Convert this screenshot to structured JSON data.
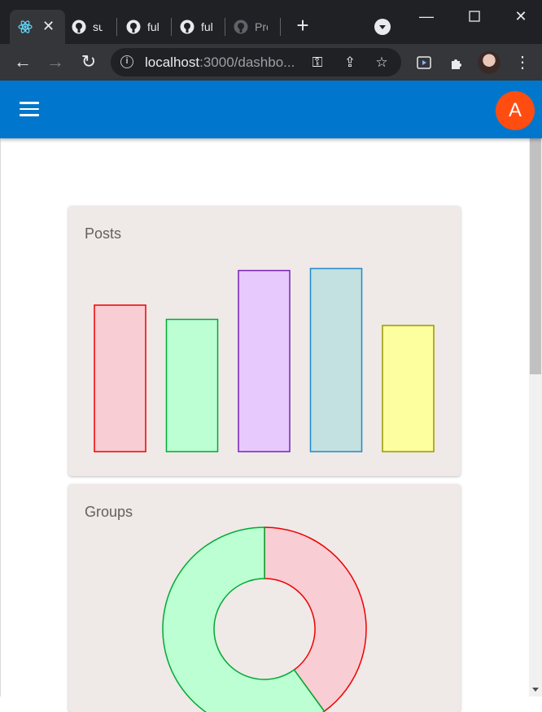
{
  "browser": {
    "tabs": [
      {
        "title": "",
        "icon": "react-icon",
        "active": true
      },
      {
        "title": "su",
        "icon": "github-icon"
      },
      {
        "title": "ful",
        "icon": "github-icon"
      },
      {
        "title": "ful",
        "icon": "github-icon"
      },
      {
        "title": "Pro",
        "icon": "github-icon"
      }
    ],
    "url_host": "localhost",
    "url_rest": ":3000/dashbo..."
  },
  "app": {
    "avatar_letter": "A"
  },
  "cards": {
    "posts_title": "Posts",
    "groups_title": "Groups"
  },
  "colors": {
    "appbar": "#0077cc",
    "avatar": "#ff4d12",
    "card_bg": "#efe9e7"
  },
  "chart_data": [
    {
      "type": "bar",
      "categories": [
        "",
        "",
        "",
        "",
        ""
      ],
      "values": [
        7.2,
        6.5,
        8.9,
        9.0,
        6.2
      ],
      "ylim": [
        0,
        10
      ],
      "colors": {
        "fill": [
          "#f8cdd4",
          "#bbffd3",
          "#e8c9fe",
          "#c3e1e1",
          "#fdfe9e"
        ],
        "stroke": [
          "#ee0000",
          "#00aa33",
          "#7722bb",
          "#2288cc",
          "#999900"
        ]
      },
      "grid": false,
      "legend": false
    },
    {
      "type": "pie",
      "labels": [
        "",
        ""
      ],
      "values": [
        40,
        60
      ],
      "donut": true,
      "colors": {
        "fill": [
          "#f8cdd4",
          "#bbffd3"
        ],
        "stroke": [
          "#ee0000",
          "#00aa33"
        ]
      }
    }
  ]
}
